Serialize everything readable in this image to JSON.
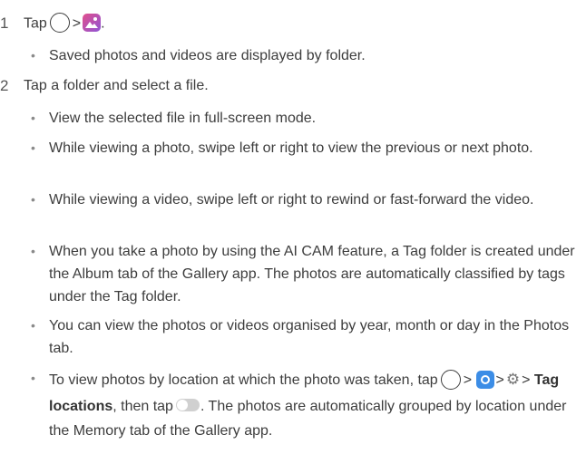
{
  "steps": [
    {
      "number": "1",
      "text_before": "Tap",
      "separator": ">",
      "end": ".",
      "bullets": [
        "Saved photos and videos are displayed by folder."
      ]
    },
    {
      "number": "2",
      "text": "Tap a folder and select a file.",
      "bullets": [
        "View the selected file in full-screen mode.",
        "While viewing a photo, swipe left or right to view the previous or next photo.",
        "While viewing a video, swipe left or right to rewind or fast-forward the video.",
        "When you take a photo by using the AI CAM feature, a Tag folder is created under the Album tab of the Gallery app. The photos are automatically classified by tags under the Tag folder.",
        "You can view the photos or videos organised by year, month or day in the Photos tab."
      ],
      "last_bullet": {
        "part1": "To view photos by location at which the photo was taken, tap",
        "sep": ">",
        "bold": "Tag locations",
        "part2": ", then tap",
        "part3": ". The photos are automatically grouped by location under the Memory tab of the Gallery app."
      }
    }
  ],
  "bullet_glyph": "•",
  "icons": [
    "home-button-icon",
    "gallery-app-icon",
    "camera-app-icon",
    "settings-gear-icon",
    "toggle-switch-icon"
  ]
}
